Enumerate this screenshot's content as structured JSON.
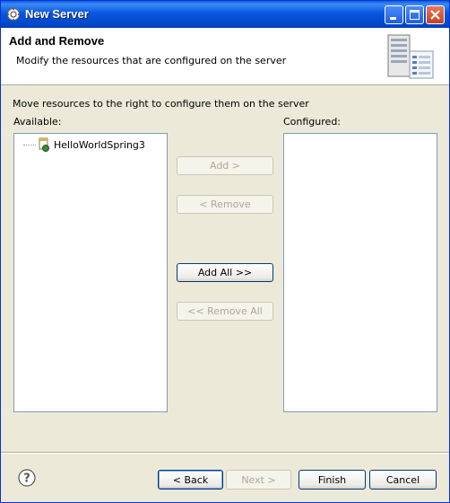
{
  "window": {
    "title": "New Server",
    "close_label": "×"
  },
  "header": {
    "title": "Add and Remove",
    "description": "Modify the resources that are configured on the server"
  },
  "instruction": "Move resources to the right to configure them on the server",
  "available": {
    "label": "Available:",
    "items": [
      "HelloWorldSpring3"
    ]
  },
  "configured": {
    "label": "Configured:",
    "items": []
  },
  "buttons": {
    "add": "Add >",
    "remove": "< Remove",
    "add_all": "Add All >>",
    "remove_all": "<< Remove All"
  },
  "footer": {
    "help_glyph": "?",
    "back": "< Back",
    "next": "Next >",
    "finish": "Finish",
    "cancel": "Cancel"
  },
  "colors": {
    "titlebar": "#0a5ce2",
    "dialog_bg": "#ece9d8",
    "list_border": "#7f9db9"
  }
}
